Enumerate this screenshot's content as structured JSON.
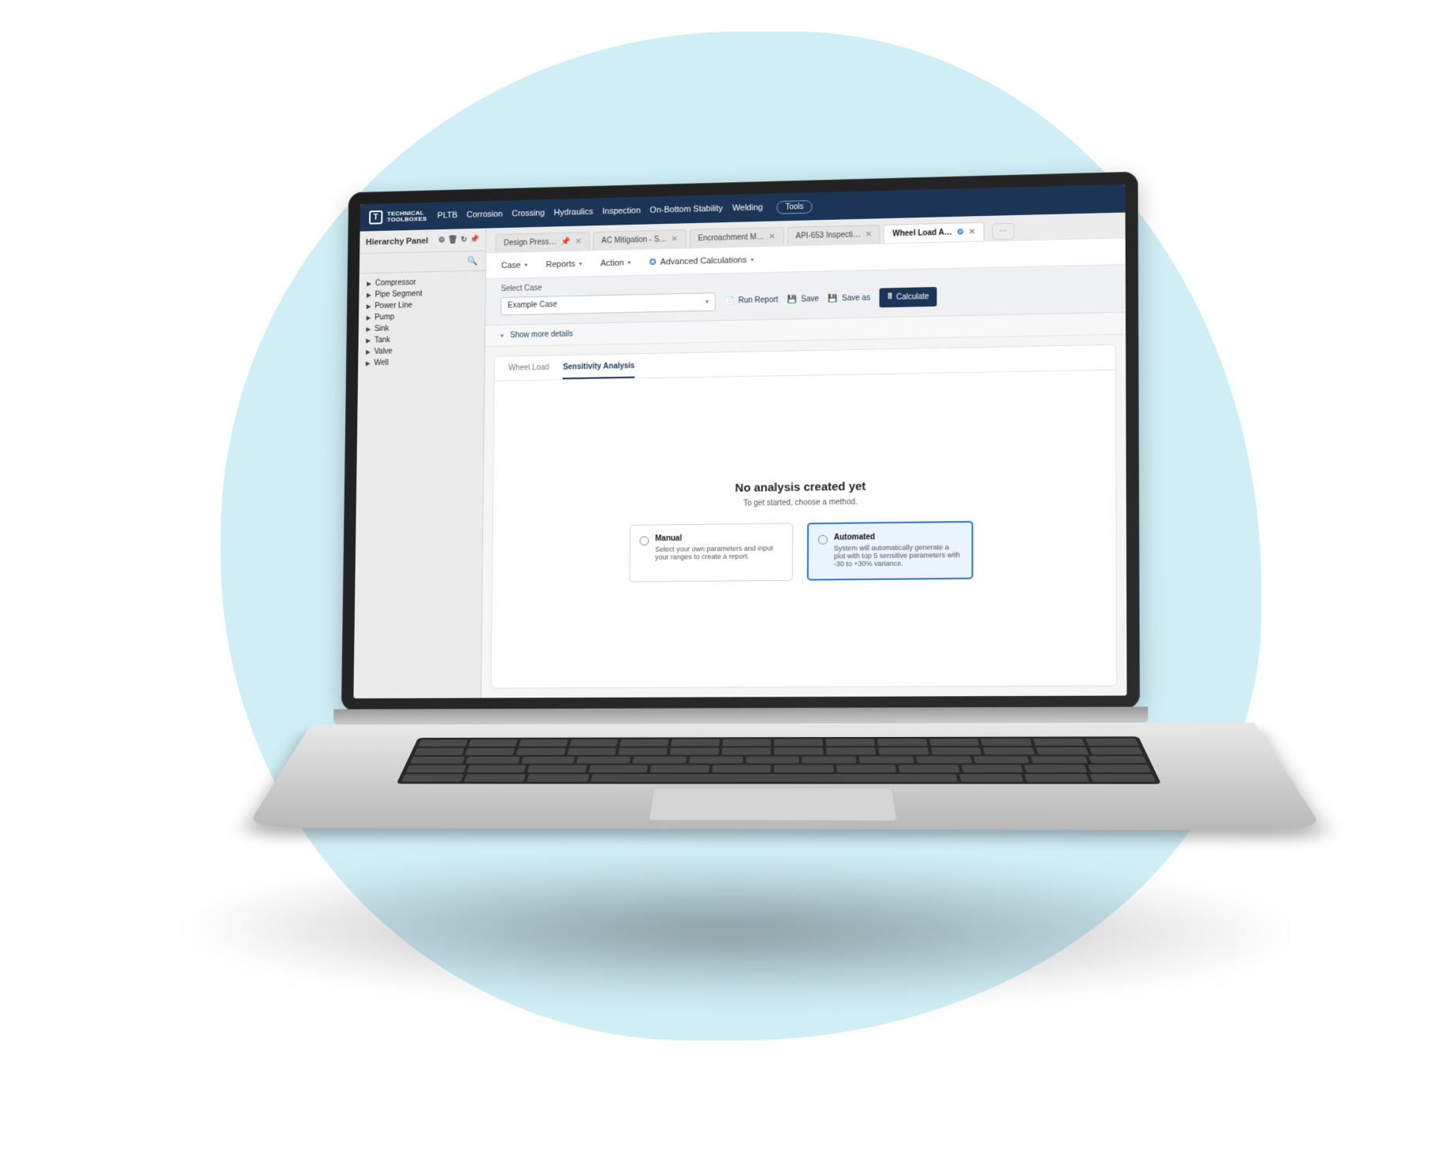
{
  "brand": {
    "mark": "T",
    "line1": "TECHNICAL",
    "line2": "TOOLBOXES"
  },
  "nav": {
    "items": [
      "PLTB",
      "Corrosion",
      "Crossing",
      "Hydraulics",
      "Inspection",
      "On-Bottom Stability",
      "Welding"
    ],
    "tools": "Tools"
  },
  "sidebar": {
    "title": "Hierarchy Panel",
    "items": [
      "Compressor",
      "Pipe Segment",
      "Power Line",
      "Pump",
      "Sink",
      "Tank",
      "Valve",
      "Well"
    ]
  },
  "tabs": {
    "items": [
      {
        "label": "Design Press…",
        "active": false
      },
      {
        "label": "AC Mitigation - S…",
        "active": false
      },
      {
        "label": "Encroachment M…",
        "active": false
      },
      {
        "label": "API-653 Inspecti…",
        "active": false
      },
      {
        "label": "Wheel Load A…",
        "active": true
      }
    ],
    "more": "⋯"
  },
  "submenu": {
    "case": "Case",
    "reports": "Reports",
    "action": "Action",
    "advanced": "Advanced Calculations"
  },
  "caseBar": {
    "label": "Select Case",
    "selected": "Example Case",
    "run": "Run Report",
    "save": "Save",
    "saveAs": "Save as",
    "calculate": "Calculate"
  },
  "moreDetails": "Show more details",
  "innerTabs": {
    "a": "Wheel Load",
    "b": "Sensitivity Analysis"
  },
  "empty": {
    "title": "No analysis created yet",
    "subtitle": "To get started, choose a method."
  },
  "methods": {
    "manual": {
      "title": "Manual",
      "desc": "Select your own parameters and input your ranges to create a report."
    },
    "auto": {
      "title": "Automated",
      "desc": "System will automatically generate a plot with top 5 sensitive parameters with -30 to +30% variance."
    }
  }
}
